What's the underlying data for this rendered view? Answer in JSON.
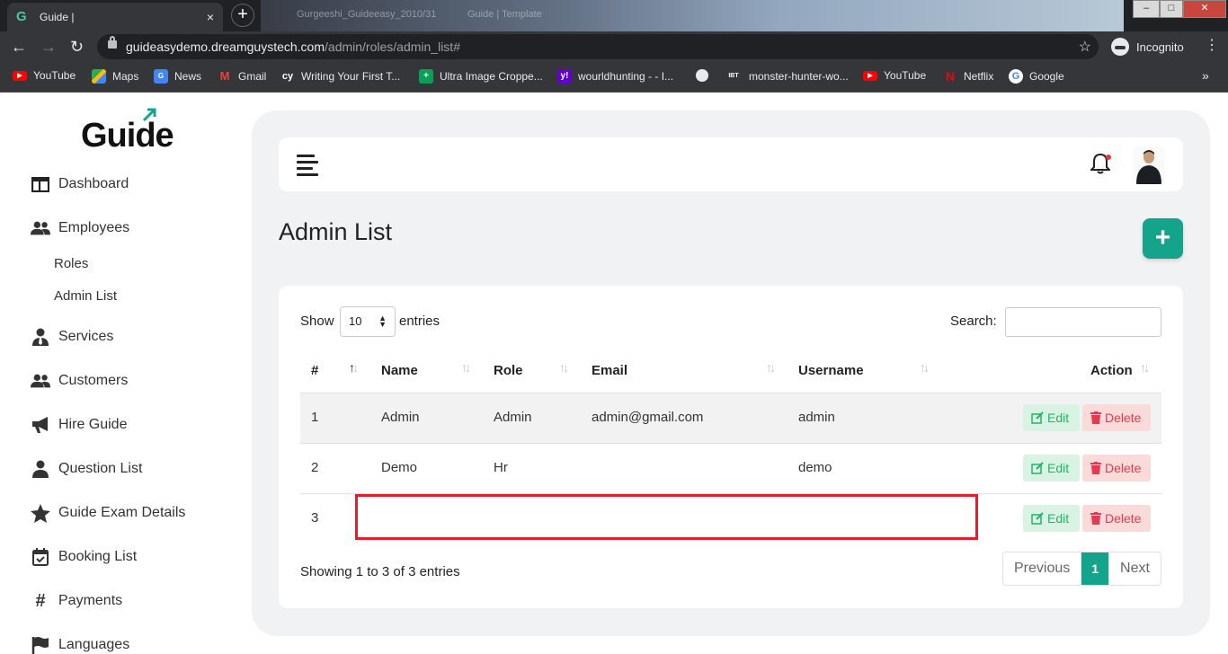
{
  "browser": {
    "tab_title": "Guide |",
    "tab_close": "×",
    "new_tab": "+",
    "ghost_tabs": [
      "Gurgeeshi_Guideeasy_2010/31",
      "Guide | Template"
    ],
    "url_host": "guideasydemo.dreamguystech.com",
    "url_path": "/admin/roles/admin_list#",
    "incognito_label": "Incognito",
    "bookmarks": [
      {
        "label": "YouTube",
        "icon": "youtube-icon",
        "color": "#ff0000"
      },
      {
        "label": "Maps",
        "icon": "maps-icon",
        "color": "#34a853"
      },
      {
        "label": "News",
        "icon": "news-icon",
        "color": "#4285f4"
      },
      {
        "label": "Gmail",
        "icon": "gmail-icon",
        "color": "#ea4335"
      },
      {
        "label": "Writing Your First T...",
        "icon": "cy-icon",
        "color": "#35363a"
      },
      {
        "label": "Ultra Image Croppe...",
        "icon": "sheets-icon",
        "color": "#0f9d58"
      },
      {
        "label": "wourldhunting - - I...",
        "icon": "yahoo-icon",
        "color": "#6001d2"
      },
      {
        "label": "",
        "icon": "globe-icon",
        "color": "#e8eaed"
      },
      {
        "label": "monster-hunter-wo...",
        "icon": "ibt-icon",
        "color": "#35363a"
      },
      {
        "label": "YouTube",
        "icon": "youtube-icon",
        "color": "#ff0000"
      },
      {
        "label": "Netflix",
        "icon": "netflix-icon",
        "color": "#e50914"
      },
      {
        "label": "Google",
        "icon": "google-icon",
        "color": "#4285f4"
      }
    ]
  },
  "app": {
    "logo_text": "Guide",
    "accent_color": "#14a38b",
    "sidebar": {
      "items": [
        {
          "label": "Dashboard",
          "icon": "dashboard-icon"
        },
        {
          "label": "Employees",
          "icon": "users-icon"
        },
        {
          "label": "Services",
          "icon": "user-tie-icon"
        },
        {
          "label": "Customers",
          "icon": "users-icon"
        },
        {
          "label": "Hire Guide",
          "icon": "megaphone-icon"
        },
        {
          "label": "Question List",
          "icon": "user-icon"
        },
        {
          "label": "Guide Exam Details",
          "icon": "star-icon"
        },
        {
          "label": "Booking List",
          "icon": "calendar-check-icon"
        },
        {
          "label": "Payments",
          "icon": "hashtag-icon"
        },
        {
          "label": "Languages",
          "icon": "flag-icon"
        }
      ],
      "employee_subitems": [
        "Roles",
        "Admin List"
      ]
    },
    "page_title": "Admin List",
    "add_button": "+",
    "table": {
      "show_label": "Show",
      "entries_value": "10",
      "entries_label": "entries",
      "search_label": "Search:",
      "search_value": "",
      "columns": [
        "#",
        "Name",
        "Role",
        "Email",
        "Username",
        "Action"
      ],
      "rows": [
        {
          "num": "1",
          "name": "Admin",
          "role": "Admin",
          "email": "admin@gmail.com",
          "username": "admin"
        },
        {
          "num": "2",
          "name": "Demo",
          "role": "Hr",
          "email": "",
          "username": "demo"
        },
        {
          "num": "3",
          "name": "",
          "role": "",
          "email": "",
          "username": ""
        }
      ],
      "edit_label": "Edit",
      "delete_label": "Delete",
      "info": "Showing 1 to 3 of 3 entries",
      "pagination": {
        "prev": "Previous",
        "current": "1",
        "next": "Next"
      }
    }
  }
}
